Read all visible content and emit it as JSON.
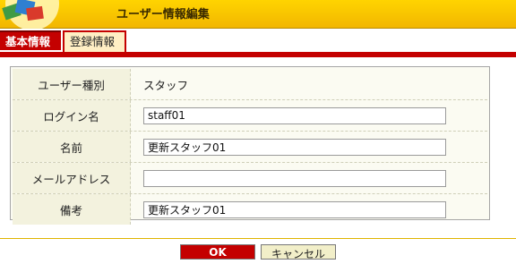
{
  "header": {
    "title": "ユーザー情報編集"
  },
  "tabs": [
    {
      "label": "基本情報",
      "active": true
    },
    {
      "label": "登録情報",
      "active": false
    }
  ],
  "form": {
    "user_type": {
      "label": "ユーザー種別",
      "value": "スタッフ"
    },
    "login_name": {
      "label": "ログイン名",
      "value": "staff01"
    },
    "name": {
      "label": "名前",
      "value": "更新スタッフ01"
    },
    "email": {
      "label": "メールアドレス",
      "value": ""
    },
    "remarks": {
      "label": "備考",
      "value": "更新スタッフ01"
    }
  },
  "buttons": {
    "ok": "OK",
    "cancel": "キャンセル"
  },
  "colors": {
    "header_yellow": "#f2b600",
    "tab_red": "#c40000",
    "form_bg": "#fbfbf2"
  }
}
